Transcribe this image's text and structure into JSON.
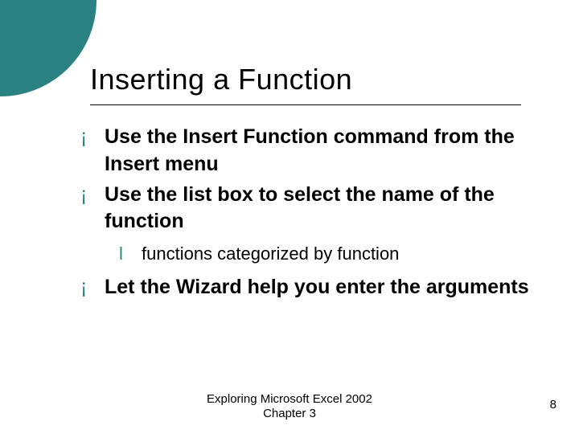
{
  "title": "Inserting a Function",
  "bullets": [
    {
      "level": 1,
      "text": "Use the Insert Function command from the Insert menu"
    },
    {
      "level": 1,
      "text": "Use the list box to select the name of the function"
    },
    {
      "level": 2,
      "text": "functions categorized by function"
    },
    {
      "level": 1,
      "text": "Let the Wizard help you enter the arguments"
    }
  ],
  "footer": {
    "line1": "Exploring Microsoft Excel 2002",
    "line2": "Chapter 3"
  },
  "page_number": "8",
  "glyphs": {
    "lvl1": "¡",
    "lvl2": "l"
  }
}
